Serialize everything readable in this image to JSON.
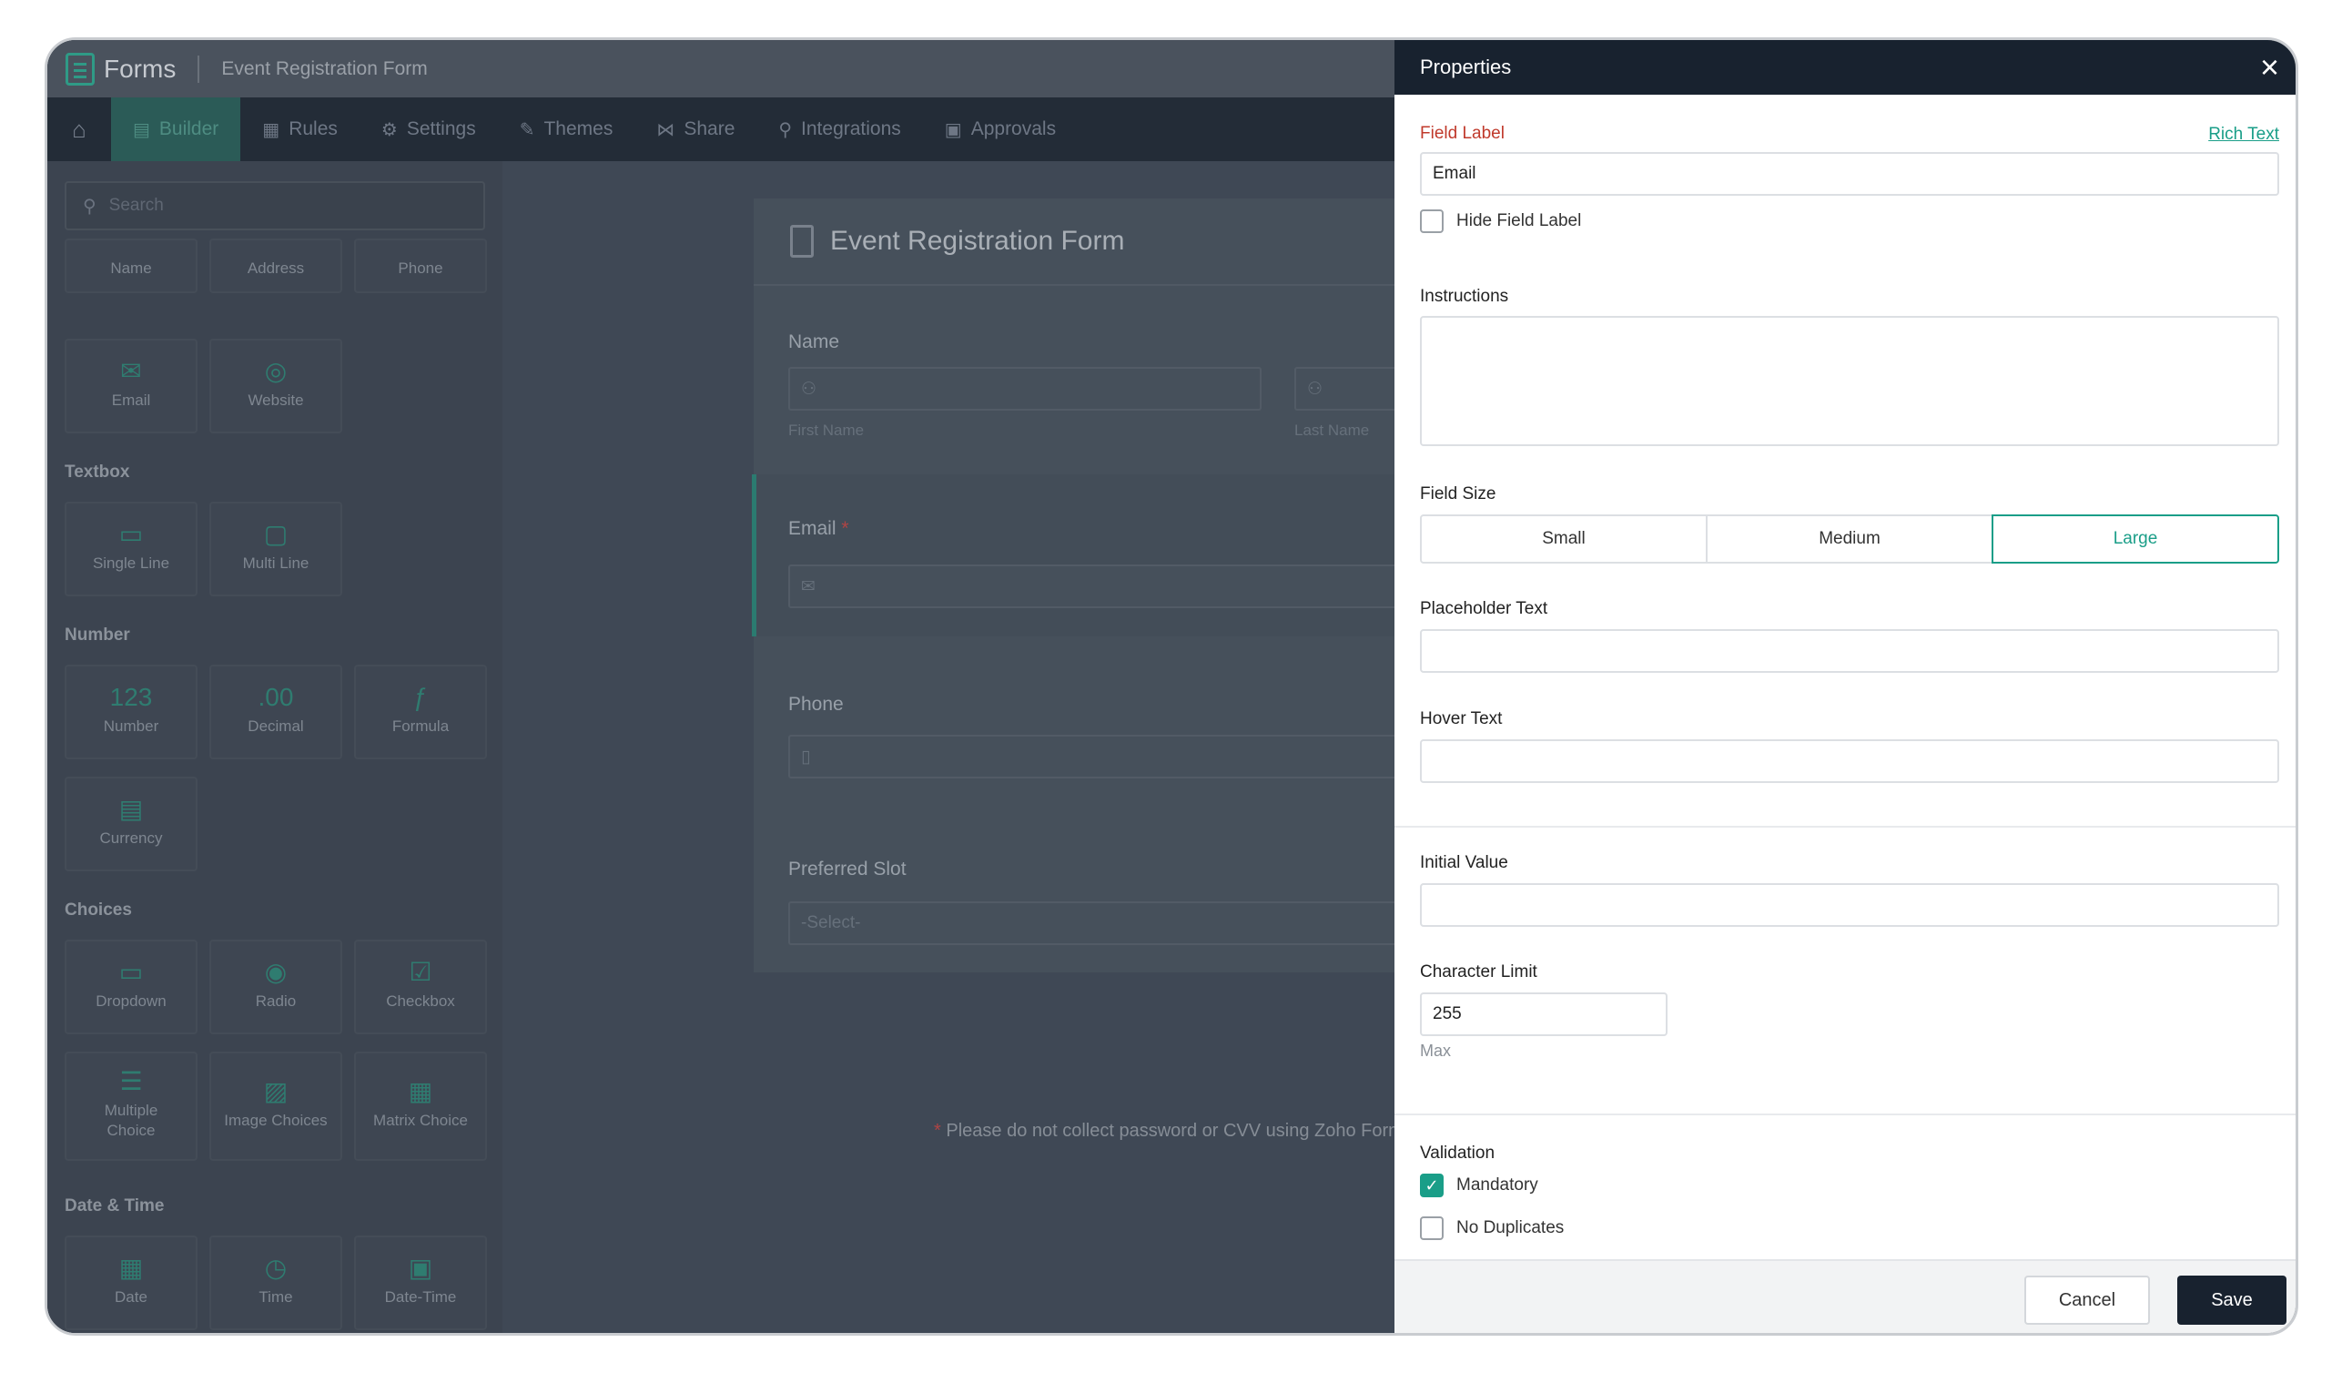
{
  "app": {
    "brand": "Forms",
    "form_title": "Event Registration Form"
  },
  "nav": {
    "home_icon": "home-icon",
    "items": [
      {
        "label": "Builder",
        "icon": "builder-icon",
        "active": true
      },
      {
        "label": "Rules",
        "icon": "rules-icon"
      },
      {
        "label": "Settings",
        "icon": "gear-icon"
      },
      {
        "label": "Themes",
        "icon": "brush-icon"
      },
      {
        "label": "Share",
        "icon": "share-icon"
      },
      {
        "label": "Integrations",
        "icon": "plug-icon"
      },
      {
        "label": "Approvals",
        "icon": "approvals-icon"
      }
    ]
  },
  "sidebar": {
    "search_placeholder": "Search",
    "top_tiles": [
      "Name",
      "Address",
      "Phone"
    ],
    "tiles_row2": [
      "Email",
      "Website"
    ],
    "sections": {
      "textbox": "Textbox",
      "number": "Number",
      "choices": "Choices",
      "datetime": "Date & Time"
    },
    "textbox_tiles": [
      "Single Line",
      "Multi Line"
    ],
    "number_tiles": [
      "Number",
      "Decimal",
      "Formula",
      "Currency"
    ],
    "choices_tiles": [
      "Dropdown",
      "Radio",
      "Checkbox",
      "Multiple Choice",
      "Image Choices",
      "Matrix Choice"
    ],
    "datetime_tiles": [
      "Date",
      "Time",
      "Date-Time"
    ]
  },
  "form": {
    "title": "Event Registration Form",
    "name_label": "Name",
    "first_name": "First Name",
    "last_name": "Last Name",
    "email_label": "Email",
    "required_mark": "*",
    "phone_label": "Phone",
    "slot_label": "Preferred Slot",
    "slot_placeholder": "-Select-",
    "note": "Please do not collect password or CVV using Zoho Forms."
  },
  "properties": {
    "title": "Properties",
    "field_label_heading": "Field Label",
    "rich_text_link": "Rich Text",
    "field_label_value": "Email",
    "hide_field_label": "Hide Field Label",
    "instructions_heading": "Instructions",
    "field_size_heading": "Field Size",
    "sizes": [
      "Small",
      "Medium",
      "Large"
    ],
    "selected_size": "Large",
    "placeholder_heading": "Placeholder Text",
    "hover_heading": "Hover Text",
    "initial_value_heading": "Initial Value",
    "char_limit_heading": "Character Limit",
    "char_limit_value": "255",
    "max_label": "Max",
    "validation_heading": "Validation",
    "mandatory": "Mandatory",
    "mandatory_checked": true,
    "no_duplicates": "No Duplicates",
    "no_duplicates_checked": false,
    "cancel": "Cancel",
    "save": "Save"
  },
  "colors": {
    "accent": "#1a9e88",
    "header_dark": "#18222f",
    "label_red": "#c0392b"
  }
}
